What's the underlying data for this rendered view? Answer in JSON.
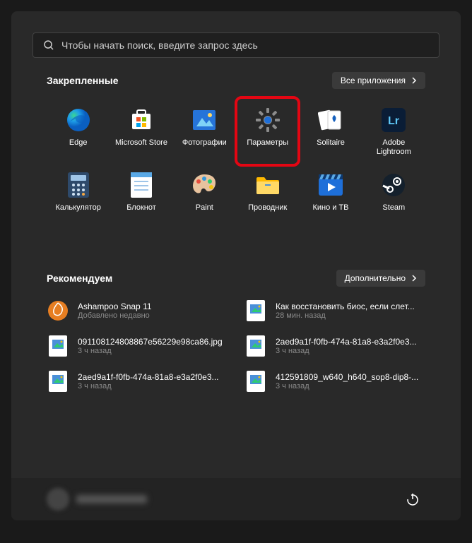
{
  "search": {
    "placeholder": "Чтобы начать поиск, введите запрос здесь"
  },
  "pinned": {
    "title": "Закрепленные",
    "all_apps": "Все приложения",
    "apps": [
      {
        "name": "Edge"
      },
      {
        "name": "Microsoft Store"
      },
      {
        "name": "Фотографии"
      },
      {
        "name": "Параметры"
      },
      {
        "name": "Solitaire"
      },
      {
        "name": "Adobe Lightroom"
      },
      {
        "name": "Калькулятор"
      },
      {
        "name": "Блокнот"
      },
      {
        "name": "Paint"
      },
      {
        "name": "Проводник"
      },
      {
        "name": "Кино и ТВ"
      },
      {
        "name": "Steam"
      }
    ]
  },
  "recommended": {
    "title": "Рекомендуем",
    "more": "Дополнительно",
    "items": [
      {
        "title": "Ashampoo Snap 11",
        "sub": "Добавлено недавно"
      },
      {
        "title": "Как восстановить биос, если слет...",
        "sub": "28 мин. назад"
      },
      {
        "title": "091108124808867e56229e98ca86.jpg",
        "sub": "3 ч назад"
      },
      {
        "title": "2aed9a1f-f0fb-474a-81a8-e3a2f0e3...",
        "sub": "3 ч назад"
      },
      {
        "title": "2aed9a1f-f0fb-474a-81a8-e3a2f0e3...",
        "sub": "3 ч назад"
      },
      {
        "title": "412591809_w640_h640_sop8-dip8-...",
        "sub": "3 ч назад"
      }
    ]
  }
}
